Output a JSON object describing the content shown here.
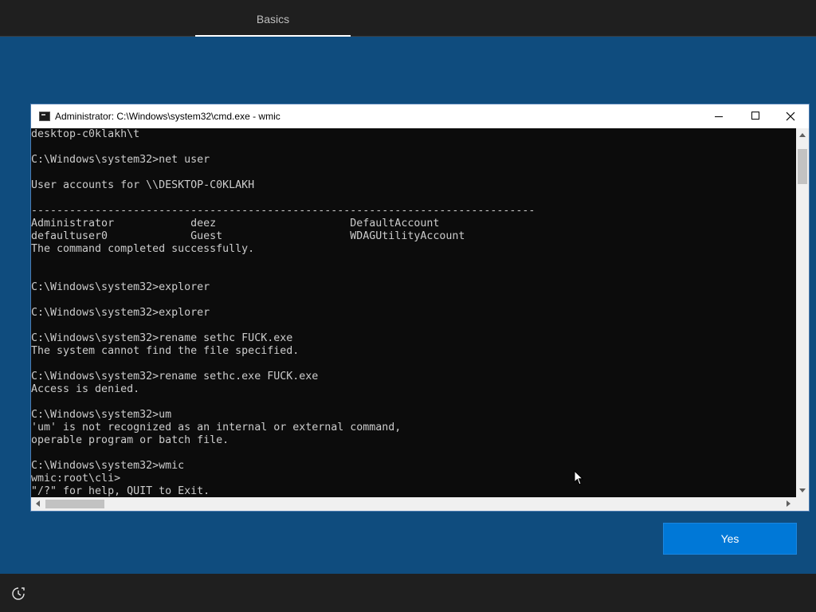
{
  "header": {
    "tab_label": "Basics"
  },
  "cmd": {
    "title": "Administrator: C:\\Windows\\system32\\cmd.exe - wmic",
    "window_icon": "cmd-icon",
    "lines": [
      "desktop-c0klakh\\t",
      "",
      "C:\\Windows\\system32>net user",
      "",
      "User accounts for \\\\DESKTOP-C0KLAKH",
      "",
      "-------------------------------------------------------------------------------",
      "Administrator            deez                     DefaultAccount",
      "defaultuser0             Guest                    WDAGUtilityAccount",
      "The command completed successfully.",
      "",
      "",
      "C:\\Windows\\system32>explorer",
      "",
      "C:\\Windows\\system32>explorer",
      "",
      "C:\\Windows\\system32>rename sethc FUCK.exe",
      "The system cannot find the file specified.",
      "",
      "C:\\Windows\\system32>rename sethc.exe FUCK.exe",
      "Access is denied.",
      "",
      "C:\\Windows\\system32>um",
      "'um' is not recognized as an internal or external command,",
      "operable program or batch file.",
      "",
      "C:\\Windows\\system32>wmic",
      "wmic:root\\cli>",
      "\"/?\" for help, QUIT to Exit."
    ]
  },
  "footer": {
    "yes_label": "Yes",
    "accessibility_icon": "accessibility-icon"
  },
  "colors": {
    "background": "#0f4c7e",
    "bars": "#1f1f1f",
    "accent": "#0078d7",
    "console_bg": "#0c0c0c",
    "console_text": "#cccccc"
  }
}
